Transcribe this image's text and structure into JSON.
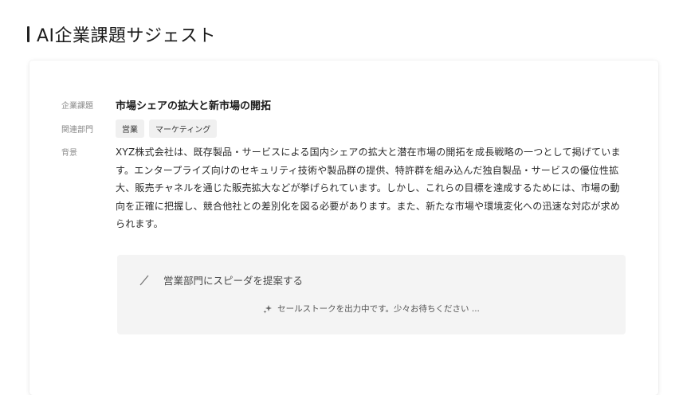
{
  "header": {
    "title": "AI企業課題サジェスト"
  },
  "card": {
    "issue_label": "企業課題",
    "issue_value": "市場シェアの拡大と新市場の開拓",
    "dept_label": "関連部門",
    "departments": [
      "営業",
      "マーケティング"
    ],
    "background_label": "背景",
    "background_text": "XYZ株式会社は、既存製品・サービスによる国内シェアの拡大と潜在市場の開拓を成長戦略の一つとして掲げています。エンタープライズ向けのセキュリティ技術や製品群の提供、特許群を組み込んだ独自製品・サービスの優位性拡大、販売チャネルを通じた販売拡大などが挙げられています。しかし、これらの目標を達成するためには、市場の動向を正確に把握し、競合他社との差別化を図る必要があります。また、新たな市場や環境変化への迅速な対応が求められます。"
  },
  "suggestion": {
    "title": "営業部門にスピーダを提案する",
    "loading_text": "セールストークを出力中です。少々お待ちください ...",
    "icons": {
      "title": "slash-icon",
      "loading": "sparkle-icon"
    }
  }
}
